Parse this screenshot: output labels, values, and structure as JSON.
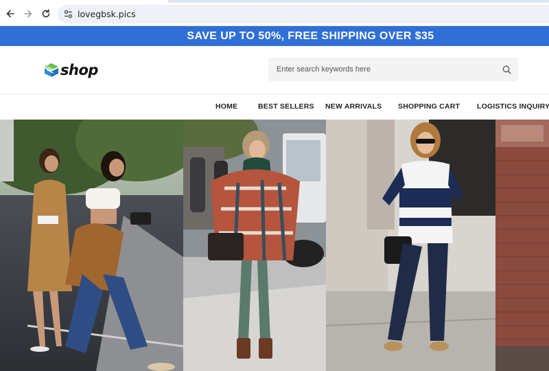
{
  "browser": {
    "url": "lovegbsk.pics",
    "icons": [
      "back-arrow-icon",
      "forward-arrow-icon",
      "reload-icon",
      "site-settings-icon"
    ]
  },
  "promo": {
    "text": "SAVE UP TO 50%, FREE SHIPPING OVER $35"
  },
  "header": {
    "logo_text": "shop",
    "search_placeholder": "Enter search keywords here",
    "search_icon": "search-icon"
  },
  "nav": {
    "items": [
      "HOME",
      "BEST SELLERS",
      "NEW ARRIVALS",
      "SHOPPING CART",
      "LOGISTICS INQUIRY"
    ]
  },
  "colors": {
    "promo_bg": "#2f6fd6",
    "logo_green": "#6cc04a",
    "logo_blue": "#2b8fd8"
  },
  "hero": {
    "photos": [
      "street-style-two-women-photo",
      "plaid-poncho-woman-photo",
      "striped-top-woman-photo",
      "brick-wall-photo"
    ]
  }
}
